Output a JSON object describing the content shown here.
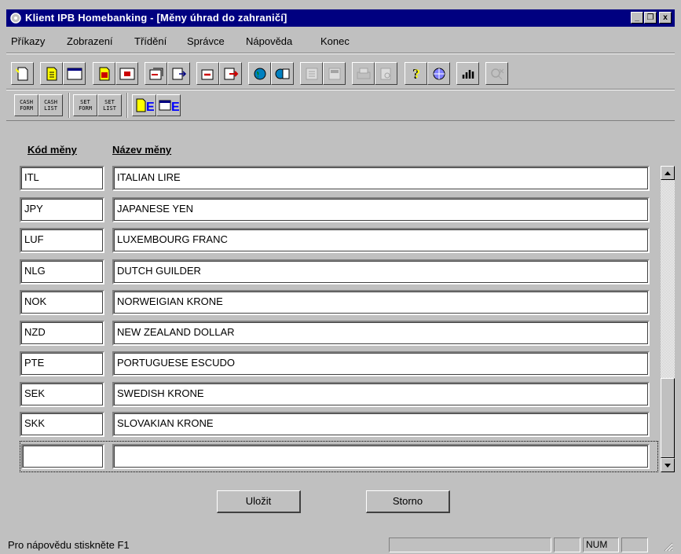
{
  "window": {
    "title": "Klient IPB Homebanking - [Měny úhrad do zahraničí]",
    "controls": {
      "minimize": "_",
      "restore": "❐",
      "close": "x"
    }
  },
  "menu": [
    "Příkazy",
    "Zobrazení",
    "Třídění",
    "Správce",
    "Nápověda",
    "Konec"
  ],
  "toolbar2": {
    "cash_form_top": "CASH",
    "cash_form_bottom": "FORM",
    "cash_list_top": "CASH",
    "cash_list_bottom": "LIST",
    "set_form_top": "SET",
    "set_form_bottom": "FORM",
    "set_list_top": "SET",
    "set_list_bottom": "LIST"
  },
  "table": {
    "headers": {
      "code": "Kód měny",
      "name": "Název měny"
    },
    "rows": [
      {
        "code": "ITL",
        "name": "ITALIAN LIRE"
      },
      {
        "code": "JPY",
        "name": "JAPANESE YEN"
      },
      {
        "code": "LUF",
        "name": "LUXEMBOURG FRANC"
      },
      {
        "code": "NLG",
        "name": "DUTCH GUILDER"
      },
      {
        "code": "NOK",
        "name": "NORWEIGIAN KRONE"
      },
      {
        "code": "NZD",
        "name": "NEW ZEALAND DOLLAR"
      },
      {
        "code": "PTE",
        "name": "PORTUGUESE ESCUDO"
      },
      {
        "code": "SEK",
        "name": "SWEDISH KRONE"
      },
      {
        "code": "SKK",
        "name": "SLOVAKIAN KRONE"
      }
    ],
    "new_row": {
      "code": "",
      "name": ""
    }
  },
  "buttons": {
    "save": "Uložit",
    "cancel": "Storno"
  },
  "status": {
    "hint": "Pro nápovědu stiskněte F1",
    "num": "NUM"
  },
  "colors": {
    "title_bar": "#000080",
    "face": "#c0c0c0"
  }
}
